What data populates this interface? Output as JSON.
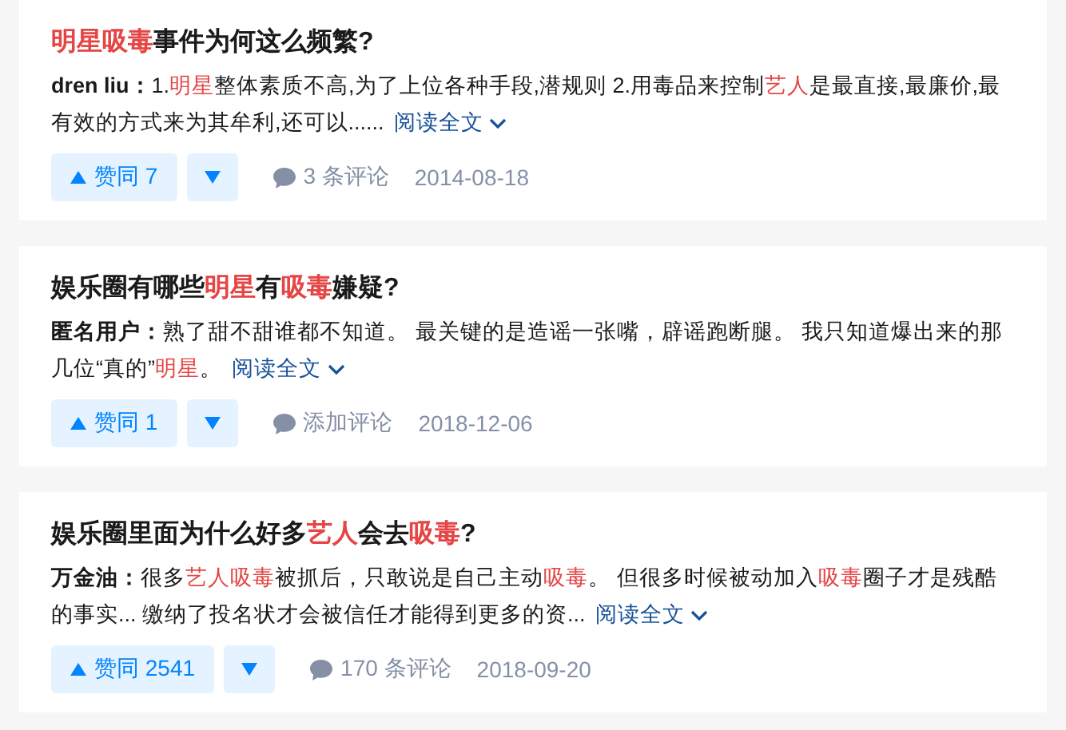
{
  "results": [
    {
      "title": [
        {
          "text": "明星吸毒",
          "highlight": true
        },
        {
          "text": "事件为何这么频繁?",
          "highlight": false
        }
      ],
      "author": "dren liu：",
      "excerpt": [
        {
          "text": "1.",
          "highlight": false
        },
        {
          "text": "明星",
          "highlight": true
        },
        {
          "text": "整体素质不高,为了上位各种手段,潜规则 2.用毒品来控制",
          "highlight": false
        },
        {
          "text": "艺人",
          "highlight": true
        },
        {
          "text": "是最直接,最廉价,最有效的方式来为其牟利,还可以......",
          "highlight": false
        }
      ],
      "read_more": "阅读全文",
      "upvote": "赞同 7",
      "comments": "3 条评论",
      "date": "2014-08-18"
    },
    {
      "title": [
        {
          "text": "娱乐圈有哪些",
          "highlight": false
        },
        {
          "text": "明星",
          "highlight": true
        },
        {
          "text": "有",
          "highlight": false
        },
        {
          "text": "吸毒",
          "highlight": true
        },
        {
          "text": "嫌疑?",
          "highlight": false
        }
      ],
      "author": "匿名用户：",
      "excerpt": [
        {
          "text": "熟了甜不甜谁都不知道。 最关键的是造谣一张嘴，辟谣跑断腿。 我只知道爆出来的那几位“真的”",
          "highlight": false
        },
        {
          "text": "明星",
          "highlight": true
        },
        {
          "text": "。",
          "highlight": false
        }
      ],
      "read_more": "阅读全文",
      "upvote": "赞同 1",
      "comments": "添加评论",
      "date": "2018-12-06"
    },
    {
      "title": [
        {
          "text": "娱乐圈里面为什么好多",
          "highlight": false
        },
        {
          "text": "艺人",
          "highlight": true
        },
        {
          "text": "会去",
          "highlight": false
        },
        {
          "text": "吸毒",
          "highlight": true
        },
        {
          "text": "?",
          "highlight": false
        }
      ],
      "author": "万金油：",
      "excerpt": [
        {
          "text": "很多",
          "highlight": false
        },
        {
          "text": "艺人吸毒",
          "highlight": true
        },
        {
          "text": "被抓后，只敢说是自己主动",
          "highlight": false
        },
        {
          "text": "吸毒",
          "highlight": true
        },
        {
          "text": "。 但很多时候被动加入",
          "highlight": false
        },
        {
          "text": "吸毒",
          "highlight": true
        },
        {
          "text": "圈子才是残酷的事实... 缴纳了投名状才会被信任才能得到更多的资...",
          "highlight": false
        }
      ],
      "read_more": "阅读全文",
      "upvote": "赞同 2541",
      "comments": "170 条评论",
      "date": "2018-09-20"
    }
  ]
}
